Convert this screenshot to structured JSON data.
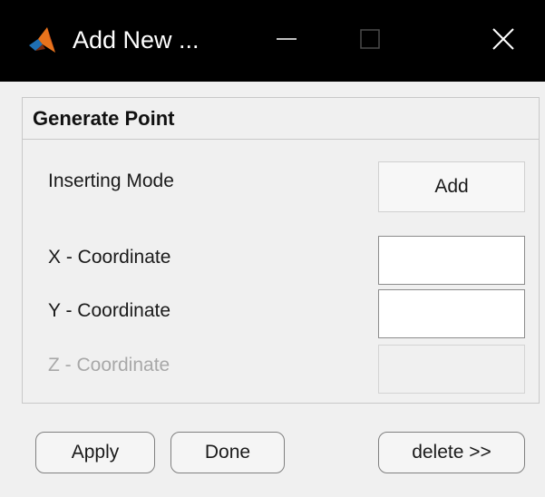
{
  "window": {
    "title": "Add New ...",
    "app_icon": "matlab-membrane-icon",
    "controls": {
      "minimize_icon": "minimize-icon",
      "maximize_icon": "maximize-icon",
      "close_icon": "close-icon"
    }
  },
  "panel": {
    "title": "Generate Point",
    "inserting_mode_label": "Inserting Mode",
    "inserting_mode_value": "Add",
    "x_label": "X - Coordinate",
    "x_value": "",
    "y_label": "Y - Coordinate",
    "y_value": "",
    "z_label": "Z - Coordinate",
    "z_value": ""
  },
  "footer": {
    "apply_label": "Apply",
    "done_label": "Done",
    "delete_label": "delete >>"
  },
  "colors": {
    "titlebar_bg": "#000000",
    "window_bg": "#f0f0f0",
    "disabled_text": "#a8a8a8",
    "icon_orange": "#e8731c",
    "icon_dark": "#7a2a0c"
  }
}
